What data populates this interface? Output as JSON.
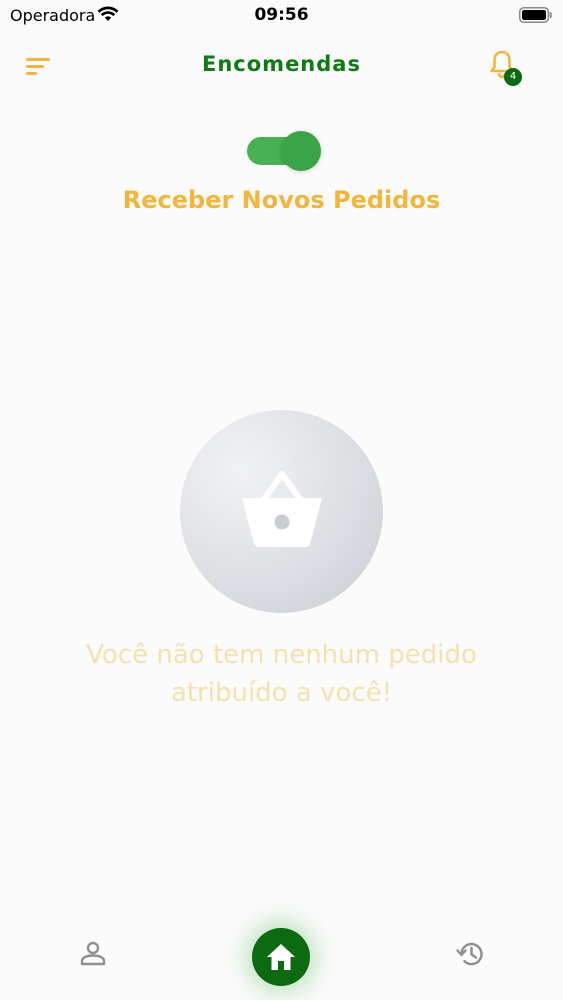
{
  "status_bar": {
    "carrier": "Operadora",
    "time": "09:56"
  },
  "header": {
    "title": "Encomendas",
    "notification_count": "4",
    "icons": {
      "menu": "menu-icon",
      "bell": "bell-icon"
    }
  },
  "toggle": {
    "label": "Receber Novos Pedidos",
    "state": "on",
    "color": "#47b153"
  },
  "empty_state": {
    "icon": "basket-icon",
    "message": "Você não tem nenhum pedido atribuído a você!"
  },
  "bottom_nav": {
    "items": [
      {
        "icon": "person-icon"
      },
      {
        "icon": "home-icon",
        "active": true
      },
      {
        "icon": "history-icon"
      }
    ]
  },
  "colors": {
    "brand_green": "#0e7a14",
    "accent_orange": "#f2b63c",
    "badge_green": "#0e6a10"
  }
}
